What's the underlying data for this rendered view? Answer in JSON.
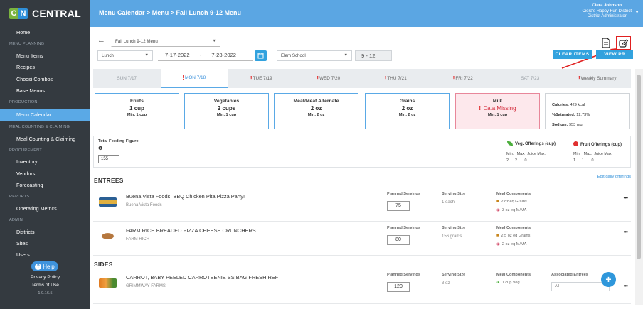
{
  "app": {
    "name": "CENTRAL",
    "logo_c": "C",
    "logo_n": "N"
  },
  "sidebar": {
    "items": [
      {
        "type": "item",
        "label": "Home"
      },
      {
        "type": "section",
        "label": "MENU PLANNING"
      },
      {
        "type": "item",
        "label": "Menu Items"
      },
      {
        "type": "item",
        "label": "Recipes"
      },
      {
        "type": "item",
        "label": "Choosi Combos"
      },
      {
        "type": "item",
        "label": "Base Menus"
      },
      {
        "type": "section",
        "label": "PRODUCTION"
      },
      {
        "type": "item",
        "label": "Menu Calendar",
        "active": true
      },
      {
        "type": "section",
        "label": "MEAL COUNTING & CLAIMING"
      },
      {
        "type": "item",
        "label": "Meal Counting & Claiming"
      },
      {
        "type": "section",
        "label": "PROCUREMENT"
      },
      {
        "type": "item",
        "label": "Inventory"
      },
      {
        "type": "item",
        "label": "Vendors"
      },
      {
        "type": "item",
        "label": "Forecasting"
      },
      {
        "type": "section",
        "label": "REPORTS"
      },
      {
        "type": "item",
        "label": "Operating Metrics"
      },
      {
        "type": "section",
        "label": "ADMIN"
      },
      {
        "type": "item",
        "label": "Districts"
      },
      {
        "type": "item",
        "label": "Sites"
      },
      {
        "type": "item",
        "label": "Users"
      }
    ],
    "help": "Help",
    "privacy": "Privacy Policy",
    "terms": "Terms of Use",
    "version": "1.0.16.5"
  },
  "header": {
    "breadcrumb": "Menu Calendar  >  Menu  >  Fall Lunch 9-12 Menu",
    "user_name": "Ciera Johnson",
    "user_district": "Ciera's Happy Fun District",
    "user_role": "District Administrator"
  },
  "toolbar": {
    "back": "←",
    "menu_select": "Fall Lunch 9-12 Menu",
    "meal": "Lunch",
    "date_from": "7-17-2022",
    "date_sep": "-",
    "date_to": "7-23-2022",
    "school": "Elem School",
    "grade": "9 - 12",
    "clear": "CLEAR ITEMS",
    "view": "VIEW PR"
  },
  "days": [
    {
      "label": "SUN 7/17",
      "state": "muted",
      "warn": false
    },
    {
      "label": "MON 7/18",
      "state": "active",
      "warn": true
    },
    {
      "label": "TUE 7/19",
      "state": "",
      "warn": true
    },
    {
      "label": "WED 7/20",
      "state": "",
      "warn": true
    },
    {
      "label": "THU 7/21",
      "state": "",
      "warn": true
    },
    {
      "label": "FRI 7/22",
      "state": "",
      "warn": true
    },
    {
      "label": "SAT 7/23",
      "state": "muted",
      "warn": false
    },
    {
      "label": "Weekly Summary",
      "state": "",
      "warn": true
    }
  ],
  "components": [
    {
      "name": "Fruits",
      "value": "1 cup",
      "min": "Min. 1 cup"
    },
    {
      "name": "Vegetables",
      "value": "2 cups",
      "min": "Min. 1 cup"
    },
    {
      "name": "Meat/Meat Alternate",
      "value": "2 oz",
      "min": "Min. 2 oz"
    },
    {
      "name": "Grains",
      "value": "2 oz",
      "min": "Min. 2 oz"
    },
    {
      "name": "Milk",
      "value": "Data Missing",
      "min": "Min. 1 cup",
      "missing": true
    }
  ],
  "nutrition": {
    "cal_label": "Calories:",
    "cal": "429 kcal",
    "sat_label": "%Saturated:",
    "sat": "12.73%",
    "sod_label": "Sodium:",
    "sod": "953 mg"
  },
  "feeding": {
    "title": "Total Feeding Figure",
    "info": "❶",
    "value": "155",
    "veg_title": "Veg. Offerings (cup)",
    "veg_head": "Min:   Max:  Juice Max:",
    "veg_vals": "2      2       0",
    "fruit_title": "Fruit Offerings (cup)",
    "fruit_head": "Min:   Max:  Juice Max:",
    "fruit_vals": "1      1       0",
    "edit": "Edit daily offerings"
  },
  "labels": {
    "entrees": "ENTREES",
    "sides": "SIDES",
    "planned": "Planned Servings",
    "size": "Serving Size",
    "comps": "Meal Components",
    "assoc": "Associated Entrees",
    "more": "•••"
  },
  "entrees": [
    {
      "name": "Buena Vista Foods: BBQ Chicken Pita Pizza Party!",
      "vendor": "Buena Vista Foods",
      "planned": "75",
      "size": "1 each",
      "c1": "2 oz eq Grains",
      "c2": "3 oz eq M/MA"
    },
    {
      "name": "FARM RICH BREADED PIZZA CHEESE CRUNCHERS",
      "vendor": "FARM RICH",
      "planned": "80",
      "size": "156 grams",
      "c1": "2.5 oz eq Grains",
      "c2": "2 oz eq M/MA"
    }
  ],
  "sides": [
    {
      "name": "CARROT, BABY PEELED CARROTEENIE SS BAG FRESH REF",
      "vendor": "GRIMMWAY FARMS",
      "planned": "120",
      "size": "3 oz",
      "c1": "1 cup Veg",
      "assoc": "All"
    }
  ],
  "fab": "+",
  "colors": {
    "sidebar": "#343a40",
    "header": "#5ba6e3",
    "accent": "#32a2de",
    "alert": "#e02020"
  }
}
